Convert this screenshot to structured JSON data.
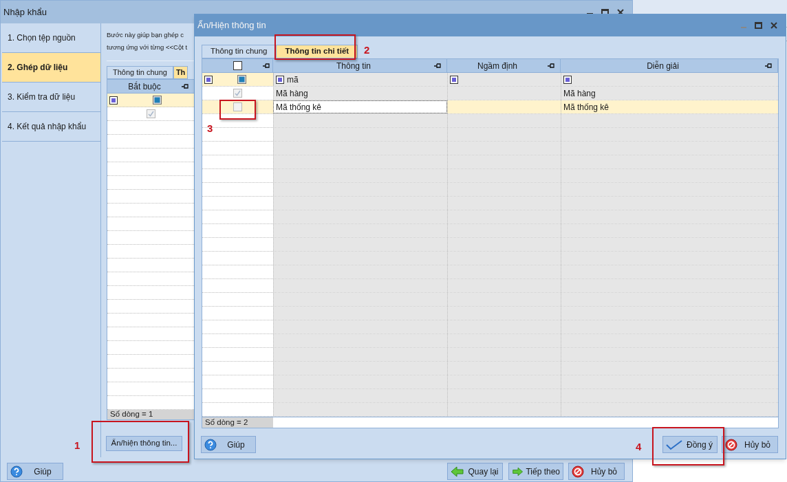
{
  "main_window": {
    "title": "Nhập khẩu",
    "steps": [
      {
        "label": "1. Chọn tệp nguồn",
        "selected": false
      },
      {
        "label": "2. Ghép dữ liệu",
        "selected": true
      },
      {
        "label": "3. Kiểm tra dữ liệu",
        "selected": false
      },
      {
        "label": "4. Kết quả nhập khẩu",
        "selected": false
      }
    ],
    "description": [
      "Bước này giúp bạn ghép c",
      "tương ứng với từng <<Cột t"
    ],
    "tabs": [
      {
        "label": "Thông tin chung",
        "selected": false
      },
      {
        "label": "Th",
        "selected": true
      }
    ],
    "column": "Bắt buộc",
    "rows": [
      {
        "checked": true
      }
    ],
    "row_count": "Số dòng = 1",
    "show_hide_button": "Ẩn/hiện thông tin...",
    "buttons": [
      {
        "label": "Giúp",
        "kind": "help"
      },
      {
        "label": "Quay lại",
        "kind": "back"
      },
      {
        "label": "Tiếp theo",
        "kind": "next"
      },
      {
        "label": "Hủy bỏ",
        "kind": "cancel"
      }
    ]
  },
  "dialog": {
    "title": "Ẩn/Hiện thông tin",
    "tabs": [
      {
        "label": "Thông tin chung",
        "selected": false
      },
      {
        "label": "Thông tin chi tiết",
        "selected": true
      }
    ],
    "header_checked": false,
    "columns": [
      "Thông tin",
      "Ngầm định",
      "Diễn giải"
    ],
    "filter": "mã",
    "rows": [
      {
        "checked": true,
        "selected": false,
        "info": "Mã hàng",
        "description": "Mã hàng"
      },
      {
        "checked": false,
        "selected": true,
        "info": "Mã thống kê",
        "description": "Mã thống kê"
      }
    ],
    "row_count": "Số dòng = 2",
    "buttons": [
      {
        "label": "Giúp",
        "kind": "help"
      },
      {
        "label": "Đồng ý",
        "kind": "ok"
      },
      {
        "label": "Hủy bỏ",
        "kind": "cancel"
      }
    ]
  },
  "annotations": [
    "1",
    "2",
    "3",
    "4"
  ]
}
